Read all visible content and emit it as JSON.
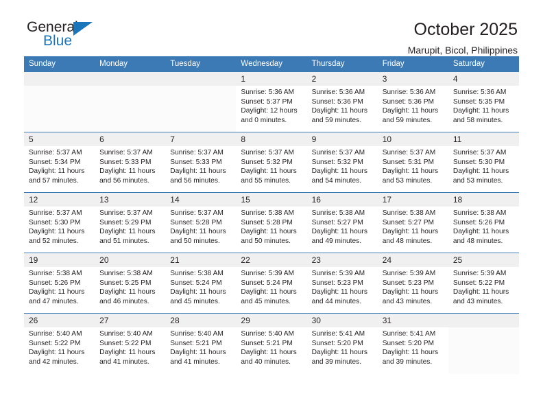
{
  "brand": {
    "name_top": "General",
    "name_bottom": "Blue"
  },
  "header": {
    "title": "October 2025",
    "location": "Marupit, Bicol, Philippines"
  },
  "theme": {
    "accent": "#3c7ab5",
    "logo_blue": "#1b75bb",
    "daynum_bg": "#f0f0f0",
    "text": "#231f20"
  },
  "weekday_headers": [
    "Sunday",
    "Monday",
    "Tuesday",
    "Wednesday",
    "Thursday",
    "Friday",
    "Saturday"
  ],
  "labels": {
    "sunrise": "Sunrise:",
    "sunset": "Sunset:",
    "daylight": "Daylight:"
  },
  "weeks": [
    [
      {
        "day": "",
        "sunrise": "",
        "sunset": "",
        "daylight_line1": "",
        "daylight_line2": "",
        "empty": true
      },
      {
        "day": "",
        "sunrise": "",
        "sunset": "",
        "daylight_line1": "",
        "daylight_line2": "",
        "empty": true
      },
      {
        "day": "",
        "sunrise": "",
        "sunset": "",
        "daylight_line1": "",
        "daylight_line2": "",
        "empty": true
      },
      {
        "day": "1",
        "sunrise": "Sunrise: 5:36 AM",
        "sunset": "Sunset: 5:37 PM",
        "daylight_line1": "Daylight: 12 hours",
        "daylight_line2": "and 0 minutes.",
        "empty": false
      },
      {
        "day": "2",
        "sunrise": "Sunrise: 5:36 AM",
        "sunset": "Sunset: 5:36 PM",
        "daylight_line1": "Daylight: 11 hours",
        "daylight_line2": "and 59 minutes.",
        "empty": false
      },
      {
        "day": "3",
        "sunrise": "Sunrise: 5:36 AM",
        "sunset": "Sunset: 5:36 PM",
        "daylight_line1": "Daylight: 11 hours",
        "daylight_line2": "and 59 minutes.",
        "empty": false
      },
      {
        "day": "4",
        "sunrise": "Sunrise: 5:36 AM",
        "sunset": "Sunset: 5:35 PM",
        "daylight_line1": "Daylight: 11 hours",
        "daylight_line2": "and 58 minutes.",
        "empty": false
      }
    ],
    [
      {
        "day": "5",
        "sunrise": "Sunrise: 5:37 AM",
        "sunset": "Sunset: 5:34 PM",
        "daylight_line1": "Daylight: 11 hours",
        "daylight_line2": "and 57 minutes.",
        "empty": false
      },
      {
        "day": "6",
        "sunrise": "Sunrise: 5:37 AM",
        "sunset": "Sunset: 5:33 PM",
        "daylight_line1": "Daylight: 11 hours",
        "daylight_line2": "and 56 minutes.",
        "empty": false
      },
      {
        "day": "7",
        "sunrise": "Sunrise: 5:37 AM",
        "sunset": "Sunset: 5:33 PM",
        "daylight_line1": "Daylight: 11 hours",
        "daylight_line2": "and 56 minutes.",
        "empty": false
      },
      {
        "day": "8",
        "sunrise": "Sunrise: 5:37 AM",
        "sunset": "Sunset: 5:32 PM",
        "daylight_line1": "Daylight: 11 hours",
        "daylight_line2": "and 55 minutes.",
        "empty": false
      },
      {
        "day": "9",
        "sunrise": "Sunrise: 5:37 AM",
        "sunset": "Sunset: 5:32 PM",
        "daylight_line1": "Daylight: 11 hours",
        "daylight_line2": "and 54 minutes.",
        "empty": false
      },
      {
        "day": "10",
        "sunrise": "Sunrise: 5:37 AM",
        "sunset": "Sunset: 5:31 PM",
        "daylight_line1": "Daylight: 11 hours",
        "daylight_line2": "and 53 minutes.",
        "empty": false
      },
      {
        "day": "11",
        "sunrise": "Sunrise: 5:37 AM",
        "sunset": "Sunset: 5:30 PM",
        "daylight_line1": "Daylight: 11 hours",
        "daylight_line2": "and 53 minutes.",
        "empty": false
      }
    ],
    [
      {
        "day": "12",
        "sunrise": "Sunrise: 5:37 AM",
        "sunset": "Sunset: 5:30 PM",
        "daylight_line1": "Daylight: 11 hours",
        "daylight_line2": "and 52 minutes.",
        "empty": false
      },
      {
        "day": "13",
        "sunrise": "Sunrise: 5:37 AM",
        "sunset": "Sunset: 5:29 PM",
        "daylight_line1": "Daylight: 11 hours",
        "daylight_line2": "and 51 minutes.",
        "empty": false
      },
      {
        "day": "14",
        "sunrise": "Sunrise: 5:37 AM",
        "sunset": "Sunset: 5:28 PM",
        "daylight_line1": "Daylight: 11 hours",
        "daylight_line2": "and 50 minutes.",
        "empty": false
      },
      {
        "day": "15",
        "sunrise": "Sunrise: 5:38 AM",
        "sunset": "Sunset: 5:28 PM",
        "daylight_line1": "Daylight: 11 hours",
        "daylight_line2": "and 50 minutes.",
        "empty": false
      },
      {
        "day": "16",
        "sunrise": "Sunrise: 5:38 AM",
        "sunset": "Sunset: 5:27 PM",
        "daylight_line1": "Daylight: 11 hours",
        "daylight_line2": "and 49 minutes.",
        "empty": false
      },
      {
        "day": "17",
        "sunrise": "Sunrise: 5:38 AM",
        "sunset": "Sunset: 5:27 PM",
        "daylight_line1": "Daylight: 11 hours",
        "daylight_line2": "and 48 minutes.",
        "empty": false
      },
      {
        "day": "18",
        "sunrise": "Sunrise: 5:38 AM",
        "sunset": "Sunset: 5:26 PM",
        "daylight_line1": "Daylight: 11 hours",
        "daylight_line2": "and 48 minutes.",
        "empty": false
      }
    ],
    [
      {
        "day": "19",
        "sunrise": "Sunrise: 5:38 AM",
        "sunset": "Sunset: 5:26 PM",
        "daylight_line1": "Daylight: 11 hours",
        "daylight_line2": "and 47 minutes.",
        "empty": false
      },
      {
        "day": "20",
        "sunrise": "Sunrise: 5:38 AM",
        "sunset": "Sunset: 5:25 PM",
        "daylight_line1": "Daylight: 11 hours",
        "daylight_line2": "and 46 minutes.",
        "empty": false
      },
      {
        "day": "21",
        "sunrise": "Sunrise: 5:38 AM",
        "sunset": "Sunset: 5:24 PM",
        "daylight_line1": "Daylight: 11 hours",
        "daylight_line2": "and 45 minutes.",
        "empty": false
      },
      {
        "day": "22",
        "sunrise": "Sunrise: 5:39 AM",
        "sunset": "Sunset: 5:24 PM",
        "daylight_line1": "Daylight: 11 hours",
        "daylight_line2": "and 45 minutes.",
        "empty": false
      },
      {
        "day": "23",
        "sunrise": "Sunrise: 5:39 AM",
        "sunset": "Sunset: 5:23 PM",
        "daylight_line1": "Daylight: 11 hours",
        "daylight_line2": "and 44 minutes.",
        "empty": false
      },
      {
        "day": "24",
        "sunrise": "Sunrise: 5:39 AM",
        "sunset": "Sunset: 5:23 PM",
        "daylight_line1": "Daylight: 11 hours",
        "daylight_line2": "and 43 minutes.",
        "empty": false
      },
      {
        "day": "25",
        "sunrise": "Sunrise: 5:39 AM",
        "sunset": "Sunset: 5:22 PM",
        "daylight_line1": "Daylight: 11 hours",
        "daylight_line2": "and 43 minutes.",
        "empty": false
      }
    ],
    [
      {
        "day": "26",
        "sunrise": "Sunrise: 5:40 AM",
        "sunset": "Sunset: 5:22 PM",
        "daylight_line1": "Daylight: 11 hours",
        "daylight_line2": "and 42 minutes.",
        "empty": false
      },
      {
        "day": "27",
        "sunrise": "Sunrise: 5:40 AM",
        "sunset": "Sunset: 5:22 PM",
        "daylight_line1": "Daylight: 11 hours",
        "daylight_line2": "and 41 minutes.",
        "empty": false
      },
      {
        "day": "28",
        "sunrise": "Sunrise: 5:40 AM",
        "sunset": "Sunset: 5:21 PM",
        "daylight_line1": "Daylight: 11 hours",
        "daylight_line2": "and 41 minutes.",
        "empty": false
      },
      {
        "day": "29",
        "sunrise": "Sunrise: 5:40 AM",
        "sunset": "Sunset: 5:21 PM",
        "daylight_line1": "Daylight: 11 hours",
        "daylight_line2": "and 40 minutes.",
        "empty": false
      },
      {
        "day": "30",
        "sunrise": "Sunrise: 5:41 AM",
        "sunset": "Sunset: 5:20 PM",
        "daylight_line1": "Daylight: 11 hours",
        "daylight_line2": "and 39 minutes.",
        "empty": false
      },
      {
        "day": "31",
        "sunrise": "Sunrise: 5:41 AM",
        "sunset": "Sunset: 5:20 PM",
        "daylight_line1": "Daylight: 11 hours",
        "daylight_line2": "and 39 minutes.",
        "empty": false
      },
      {
        "day": "",
        "sunrise": "",
        "sunset": "",
        "daylight_line1": "",
        "daylight_line2": "",
        "empty": true
      }
    ]
  ]
}
